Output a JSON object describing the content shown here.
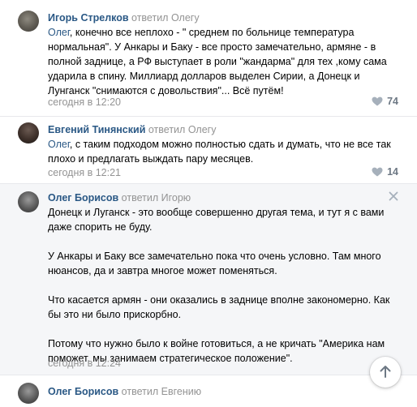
{
  "comments": [
    {
      "author": "Игорь Стрелков",
      "reply_word": "ответил",
      "reply_to": "Олегу",
      "mention": "Олег",
      "text_rest": ", конечно все неплохо - \" среднем по больнице температура нормальная\". У Анкары и Баку - все просто замечательно, армяне - в полной заднице, а РФ выступает в роли \"жандарма\" для тех ,кому сама ударила в спину. Миллиард долларов выделен Сирии, а Донецк и Лунганск \"снимаются с довольствия\"... Всё путём!",
      "date": "сегодня в 12:20",
      "likes": "74",
      "avatar_icon": "avatar-photo"
    },
    {
      "author": "Евгений Тинянский",
      "reply_word": "ответил",
      "reply_to": "Олегу",
      "mention": "Олег",
      "text_rest": ", с таким подходом можно полностью сдать и думать, что не все так плохо и предлагать выждать пару месяцев.",
      "date": "сегодня в 12:21",
      "likes": "14",
      "avatar_icon": "avatar-photo"
    },
    {
      "author": "Олег Борисов",
      "reply_word": "ответил",
      "reply_to": "Игорю",
      "paragraphs": [
        "Донецк и Луганск - это вообще совершенно другая тема, и тут я с вами даже спорить не буду.",
        "У Анкары и Баку все замечательно пока что очень условно. Там много нюансов, да и завтра многое может поменяться.",
        "Что касается армян - они оказались в заднице вполне закономерно. Как бы это ни было прискорбно.",
        "Потому что нужно было к войне готовиться, а не кричать \"Америка нам поможет, мы занимаем стратегическое положение\"."
      ],
      "date": "сегодня в 12:24",
      "close_icon": "close-icon",
      "avatar_icon": "avatar-photo"
    },
    {
      "author": "Олег Борисов",
      "reply_word": "ответил",
      "reply_to": "Евгению",
      "avatar_icon": "avatar-photo"
    }
  ],
  "colors": {
    "link": "#2a5885",
    "muted": "#939393",
    "highlight_bg": "#f5f6f8",
    "like_icon": "#a6b0bb"
  },
  "icons": {
    "like": "heart-icon",
    "scroll_up": "arrow-up-icon"
  }
}
